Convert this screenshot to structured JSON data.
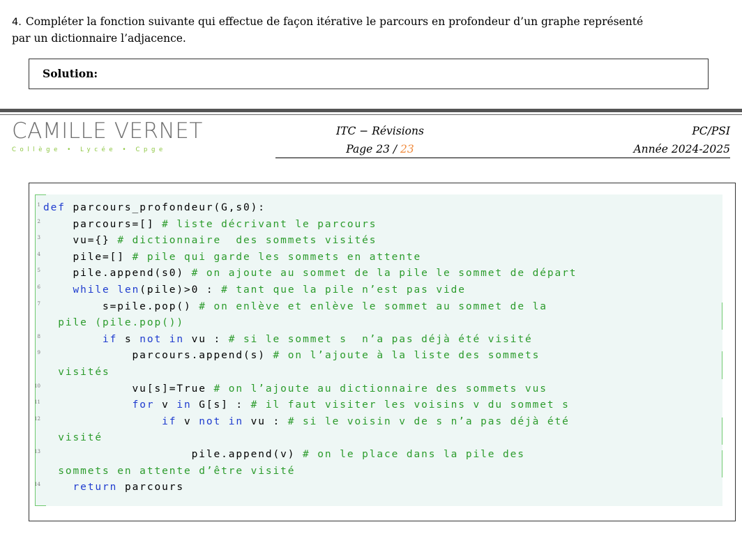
{
  "question": {
    "number": "4.",
    "text_line1": "Compléter la fonction suivante qui effectue de façon itérative le parcours en profondeur d’un graphe représenté",
    "text_line2": "par un dictionnaire l’adjacence."
  },
  "solution_label": "Solution:",
  "header": {
    "logo_text": "CAMILLE VERNET",
    "logo_subtitle": "Collège • Lycée • Cpge",
    "course": "ITC − Révisions",
    "page_label": "Page 23 / ",
    "page_total": "23",
    "track": "PC/PSI",
    "year": "Année 2024-2025"
  },
  "code_lines": [
    {
      "n": "1",
      "parts": [
        [
          "kw",
          "def"
        ],
        [
          "tx",
          " parcours_profondeur(G,s0):"
        ]
      ]
    },
    {
      "n": "2",
      "parts": [
        [
          "tx",
          "    parcours=[] "
        ],
        [
          "cm",
          "# liste décrivant le parcours"
        ]
      ]
    },
    {
      "n": "3",
      "parts": [
        [
          "tx",
          "    vu={} "
        ],
        [
          "cm",
          "# dictionnaire  des sommets visités"
        ]
      ]
    },
    {
      "n": "4",
      "parts": [
        [
          "tx",
          "    pile=[] "
        ],
        [
          "cm",
          "# pile qui garde les sommets en attente"
        ]
      ]
    },
    {
      "n": "5",
      "parts": [
        [
          "tx",
          "    pile.append(s0) "
        ],
        [
          "cm",
          "# on ajoute au sommet de la pile le sommet de départ"
        ]
      ]
    },
    {
      "n": "6",
      "parts": [
        [
          "tx",
          "    "
        ],
        [
          "kw",
          "while"
        ],
        [
          "tx",
          " "
        ],
        [
          "kw",
          "len"
        ],
        [
          "tx",
          "(pile)>0 : "
        ],
        [
          "cm",
          "# tant que la pile n’est pas vide"
        ]
      ]
    },
    {
      "n": "7",
      "parts": [
        [
          "tx",
          "        s=pile.pop() "
        ],
        [
          "cm",
          "# on enlève et enlève le sommet au sommet de la"
        ]
      ]
    },
    {
      "n": "",
      "parts": [
        [
          "cm",
          "  pile (pile.pop())"
        ]
      ]
    },
    {
      "n": "8",
      "parts": [
        [
          "tx",
          "        "
        ],
        [
          "kw",
          "if"
        ],
        [
          "tx",
          " s "
        ],
        [
          "kw",
          "not in"
        ],
        [
          "tx",
          " vu : "
        ],
        [
          "cm",
          "# si le sommet s  n’a pas déjà été visité"
        ]
      ]
    },
    {
      "n": "9",
      "parts": [
        [
          "tx",
          "            parcours.append(s) "
        ],
        [
          "cm",
          "# on l’ajoute à la liste des sommets"
        ]
      ]
    },
    {
      "n": "",
      "parts": [
        [
          "cm",
          "  visités"
        ]
      ]
    },
    {
      "n": "10",
      "parts": [
        [
          "tx",
          "            vu[s]=True "
        ],
        [
          "cm",
          "# on l’ajoute au dictionnaire des sommets vus"
        ]
      ]
    },
    {
      "n": "11",
      "parts": [
        [
          "tx",
          "            "
        ],
        [
          "kw",
          "for"
        ],
        [
          "tx",
          " v "
        ],
        [
          "kw",
          "in"
        ],
        [
          "tx",
          " G[s] : "
        ],
        [
          "cm",
          "# il faut visiter les voisins v du sommet s"
        ]
      ]
    },
    {
      "n": "12",
      "parts": [
        [
          "tx",
          "                "
        ],
        [
          "kw",
          "if"
        ],
        [
          "tx",
          " v "
        ],
        [
          "kw",
          "not in"
        ],
        [
          "tx",
          " vu : "
        ],
        [
          "cm",
          "# si le voisin v de s n’a pas déjà été"
        ]
      ]
    },
    {
      "n": "",
      "parts": [
        [
          "cm",
          "  visité"
        ]
      ]
    },
    {
      "n": "13",
      "parts": [
        [
          "tx",
          "                    pile.append(v) "
        ],
        [
          "cm",
          "# on le place dans la pile des"
        ]
      ]
    },
    {
      "n": "",
      "parts": [
        [
          "cm",
          "  sommets en attente d’être visité"
        ]
      ]
    },
    {
      "n": "14",
      "parts": [
        [
          "tx",
          "    "
        ],
        [
          "kw",
          "return"
        ],
        [
          "tx",
          " parcours"
        ]
      ]
    }
  ]
}
